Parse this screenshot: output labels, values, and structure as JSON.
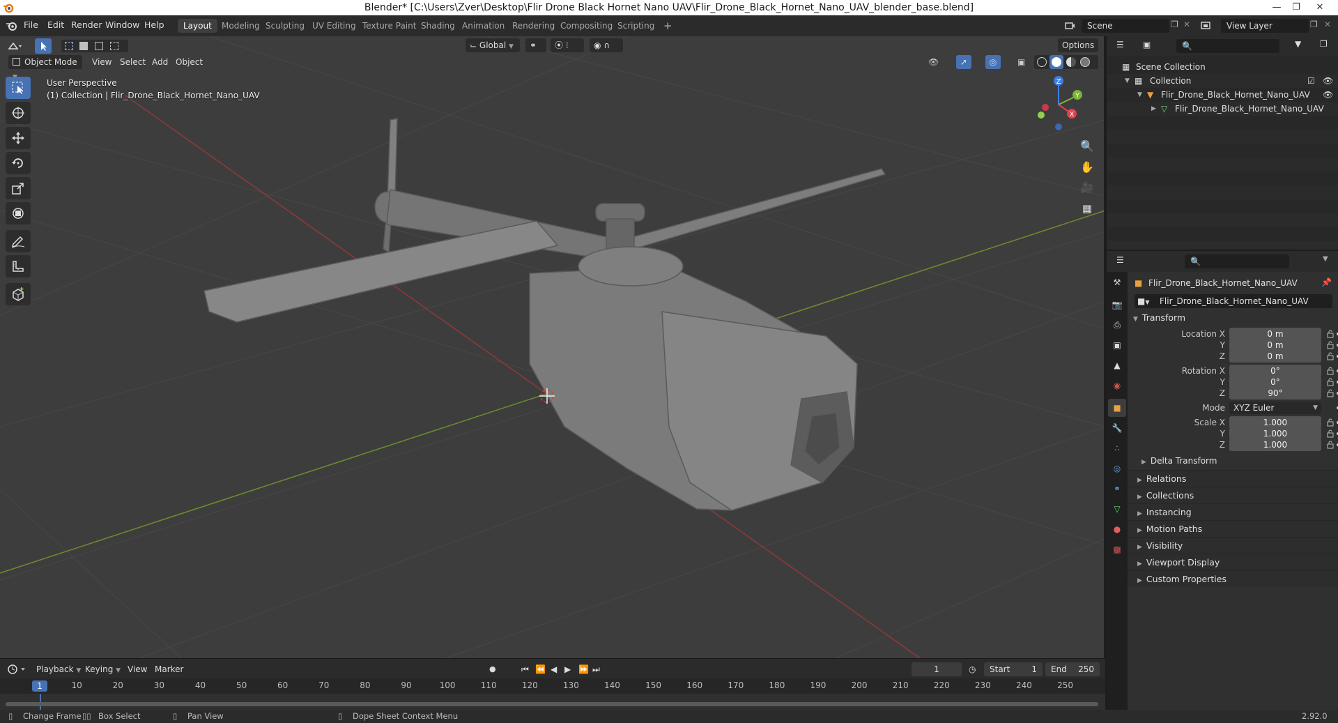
{
  "window": {
    "title": "Blender* [C:\\Users\\Zver\\Desktop\\Flir Drone Black Hornet Nano UAV\\Flir_Drone_Black_Hornet_Nano_UAV_blender_base.blend]"
  },
  "menu": [
    "File",
    "Edit",
    "Render",
    "Window",
    "Help"
  ],
  "workspaces": [
    "Layout",
    "Modeling",
    "Sculpting",
    "UV Editing",
    "Texture Paint",
    "Shading",
    "Animation",
    "Rendering",
    "Compositing",
    "Scripting"
  ],
  "active_workspace": "Layout",
  "scene": {
    "name": "Scene",
    "view_layer": "View Layer"
  },
  "viewport": {
    "mode": "Object Mode",
    "menus": [
      "View",
      "Select",
      "Add",
      "Object"
    ],
    "transform_orientation": "Global",
    "options_label": "Options",
    "info_line1": "User Perspective",
    "info_line2": "(1) Collection | Flir_Drone_Black_Hornet_Nano_UAV"
  },
  "gizmo": {
    "x": "X",
    "y": "Y",
    "z": "Z"
  },
  "timeline": {
    "menus": [
      "Playback",
      "Keying",
      "View",
      "Marker"
    ],
    "current_frame": "1",
    "start_label": "Start",
    "start_value": "1",
    "end_label": "End",
    "end_value": "250",
    "ticks": [
      "1",
      "10",
      "20",
      "30",
      "40",
      "50",
      "60",
      "70",
      "80",
      "90",
      "100",
      "110",
      "120",
      "130",
      "140",
      "150",
      "160",
      "170",
      "180",
      "190",
      "200",
      "210",
      "220",
      "230",
      "240",
      "250"
    ]
  },
  "status": {
    "change_frame": "Change Frame",
    "box_select": "Box Select",
    "pan_view": "Pan View",
    "context_menu": "Dope Sheet Context Menu",
    "version": "2.92.0"
  },
  "outliner": {
    "scene_collection": "Scene Collection",
    "collection": "Collection",
    "object": "Flir_Drone_Black_Hornet_Nano_UAV",
    "mesh": "Flir_Drone_Black_Hornet_Nano_UAV"
  },
  "properties": {
    "object_name": "Flir_Drone_Black_Hornet_Nano_UAV",
    "datablock_name": "Flir_Drone_Black_Hornet_Nano_UAV",
    "transform_label": "Transform",
    "location_label": "Location X",
    "loc_x": "0 m",
    "loc_y": "0 m",
    "loc_z": "0 m",
    "rotation_label": "Rotation X",
    "rot_x": "0°",
    "rot_y": "0°",
    "rot_z": "90°",
    "mode_label": "Mode",
    "mode_value": "XYZ Euler",
    "scale_label": "Scale X",
    "scale_x": "1.000",
    "scale_y": "1.000",
    "scale_z": "1.000",
    "axis_y": "Y",
    "axis_z": "Z",
    "delta_transform": "Delta Transform",
    "panels": [
      "Relations",
      "Collections",
      "Instancing",
      "Motion Paths",
      "Visibility",
      "Viewport Display",
      "Custom Properties"
    ]
  }
}
